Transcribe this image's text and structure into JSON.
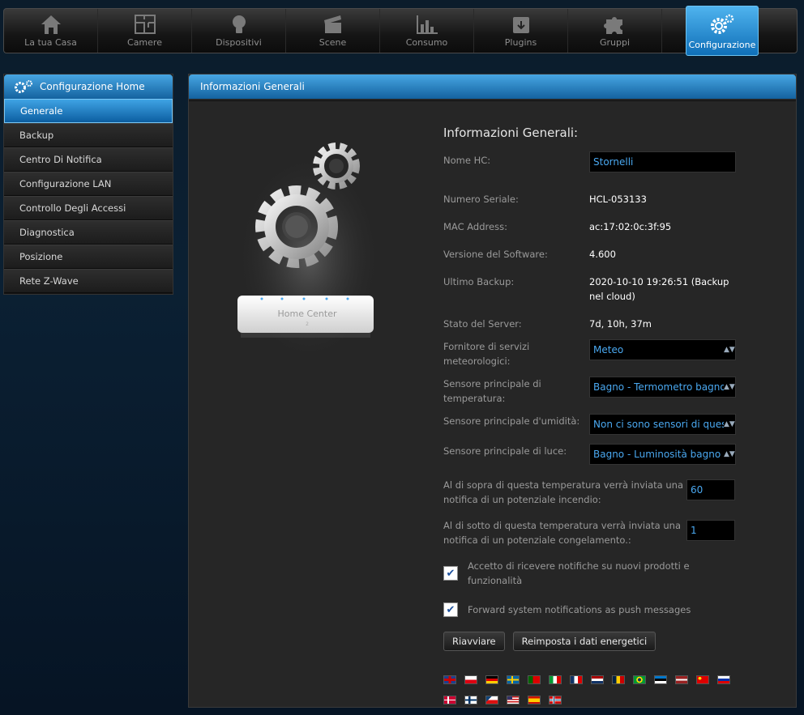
{
  "topnav": {
    "items": [
      {
        "label": "La tua Casa",
        "icon": "house-icon"
      },
      {
        "label": "Camere",
        "icon": "floorplan-icon"
      },
      {
        "label": "Dispositivi",
        "icon": "bulb-icon"
      },
      {
        "label": "Scene",
        "icon": "clapper-icon"
      },
      {
        "label": "Consumo",
        "icon": "chart-icon"
      },
      {
        "label": "Plugins",
        "icon": "box-icon"
      },
      {
        "label": "Gruppi",
        "icon": "puzzle-icon"
      },
      {
        "label": "Configurazione",
        "icon": "gears-icon"
      }
    ],
    "active_index": 7
  },
  "sidebar": {
    "title": "Configurazione Home",
    "items": [
      {
        "label": "Generale"
      },
      {
        "label": "Backup"
      },
      {
        "label": "Centro Di Notifica"
      },
      {
        "label": "Configurazione LAN"
      },
      {
        "label": "Controllo Degli Accessi"
      },
      {
        "label": "Diagnostica"
      },
      {
        "label": "Posizione"
      },
      {
        "label": "Rete Z-Wave"
      }
    ]
  },
  "main": {
    "header": "Informazioni Generali",
    "device_label": "Home Center",
    "device_sublabel": "2",
    "form": {
      "title": "Informazioni Generali:",
      "hc_name_label": "Nome HC:",
      "hc_name_value": "Stornelli",
      "serial_label": "Numero Seriale:",
      "serial_value": "HCL-053133",
      "mac_label": "MAC Address:",
      "mac_value": "ac:17:02:0c:3f:95",
      "software_label": "Versione del Software:",
      "software_value": "4.600",
      "backup_label": "Ultimo Backup:",
      "backup_value": "2020-10-10 19:26:51 (Backup nel cloud)",
      "server_label": "Stato del Server:",
      "server_value": "7d, 10h, 37m",
      "weather_label": "Fornitore di servizi meteorologici:",
      "weather_value": "Meteo",
      "temp_sensor_label": "Sensore principale di temperatura:",
      "temp_sensor_value": "Bagno - Termometro bagno",
      "humidity_label": "Sensore principale d'umidità:",
      "humidity_value": "Non ci sono sensori di questo tipo",
      "light_label": "Sensore principale di luce:",
      "light_value": "Bagno - Luminosità bagno",
      "fire_label": "Al di sopra di questa temperatura verrà inviata una notifica di un potenziale incendio:",
      "fire_value": "60",
      "freeze_label": "Al di sotto di questa temperatura verrà inviata una notifica di un potenziale congelamento.:",
      "freeze_value": "1",
      "newsletter_label": "Accetto di ricevere notifiche su nuovi prodotti e funzionalità",
      "newsletter_checked": true,
      "push_label": "Forward system notifications as push messages",
      "push_checked": true,
      "restart_button": "Riavviare",
      "reset_energy_button": "Reimposta i dati energetici"
    },
    "languages_row1": [
      "uk-flag-icon",
      "pl-flag-icon",
      "de-flag-icon",
      "se-flag-icon",
      "pt-flag-icon",
      "it-flag-icon",
      "fr-flag-icon",
      "nl-flag-icon",
      "ro-flag-icon",
      "br-flag-icon",
      "ee-flag-icon",
      "lv-flag-icon",
      "cn-flag-icon",
      "ru-flag-icon"
    ],
    "languages_row2": [
      "dk-flag-icon",
      "fi-flag-icon",
      "cz-flag-icon",
      "us-flag-icon",
      "es-flag-icon",
      "no-flag-icon"
    ]
  }
}
